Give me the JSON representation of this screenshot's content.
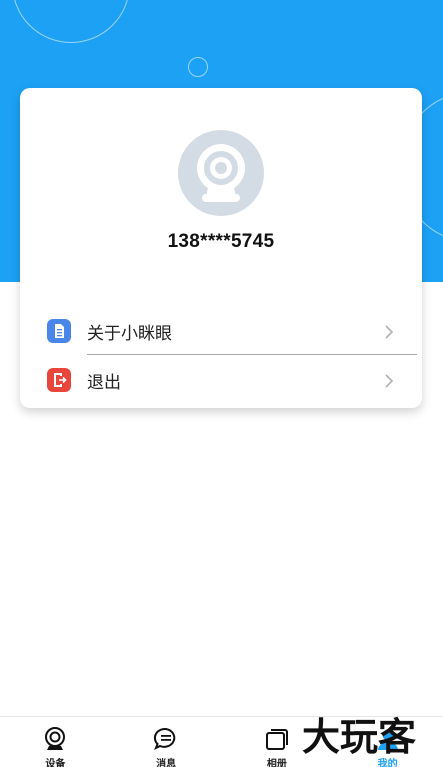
{
  "profile": {
    "phone": "138****5745"
  },
  "menu": {
    "items": [
      {
        "label": "关于小眯眼",
        "icon": "document-icon",
        "color": "#4a86e8"
      },
      {
        "label": "退出",
        "icon": "logout-icon",
        "color": "#e8453c"
      }
    ]
  },
  "tab_bar": {
    "tabs": [
      {
        "label": "设备",
        "icon": "camera-icon",
        "active": false
      },
      {
        "label": "消息",
        "icon": "message-icon",
        "active": false
      },
      {
        "label": "相册",
        "icon": "album-icon",
        "active": false
      },
      {
        "label": "我的",
        "icon": "user-icon",
        "active": true
      }
    ]
  },
  "watermark": {
    "text": "大玩客"
  },
  "colors": {
    "brand": "#1da1f5",
    "avatar_bg": "#d3dbe5"
  }
}
